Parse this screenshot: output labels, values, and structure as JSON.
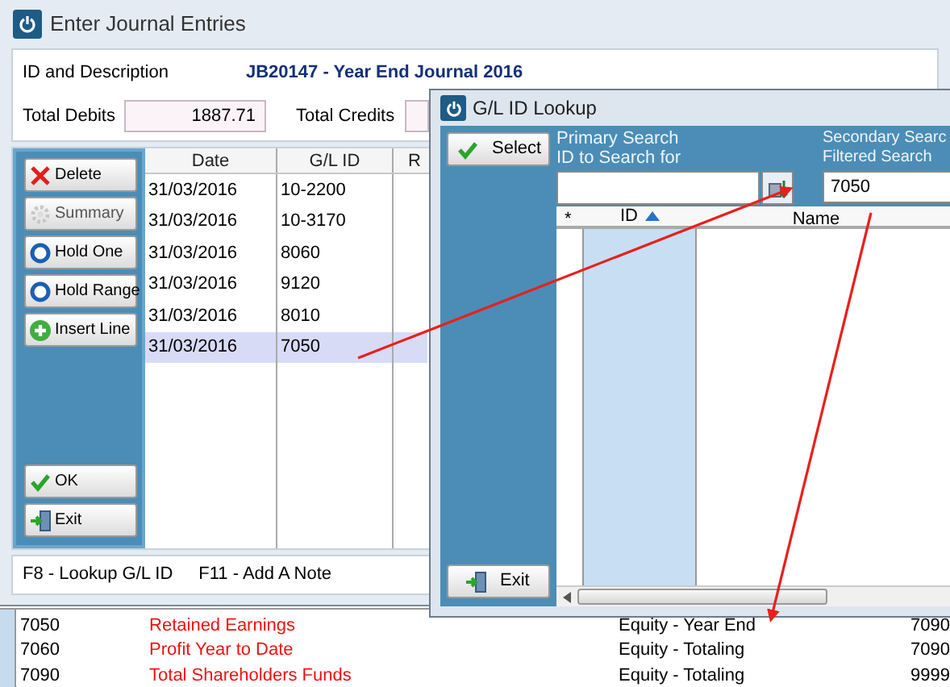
{
  "main_window": {
    "title": "Enter Journal Entries",
    "id_label": "ID and Description",
    "id_value": "JB20147 - Year End Journal 2016",
    "totals": [
      {
        "label": "Total Debits",
        "value": "1887.71"
      },
      {
        "label": "Total Credits"
      }
    ],
    "actions": [
      {
        "label": "Delete",
        "kind": "delete",
        "disabled": false
      },
      {
        "label": "Summary",
        "kind": "summary",
        "disabled": true
      },
      {
        "label": "Hold One",
        "kind": "hold",
        "disabled": false
      },
      {
        "label": "Hold Range",
        "kind": "hold",
        "disabled": false
      },
      {
        "label": "Insert Line",
        "kind": "insert",
        "disabled": false
      }
    ],
    "bottom_actions": [
      {
        "label": "OK",
        "kind": "ok"
      },
      {
        "label": "Exit",
        "kind": "exit"
      }
    ],
    "grid": {
      "columns": [
        "Date",
        "G/L ID",
        "R"
      ],
      "rows": [
        {
          "date": "31/03/2016",
          "gl_id": "10-2200",
          "selected": false
        },
        {
          "date": "31/03/2016",
          "gl_id": "10-3170",
          "selected": false
        },
        {
          "date": "31/03/2016",
          "gl_id": "8060",
          "selected": false
        },
        {
          "date": "31/03/2016",
          "gl_id": "9120",
          "selected": false
        },
        {
          "date": "31/03/2016",
          "gl_id": "8010",
          "selected": false
        },
        {
          "date": "31/03/2016",
          "gl_id": "7050",
          "selected": true
        }
      ]
    },
    "hints": [
      "F8 - Lookup G/L ID",
      "F11 - Add A Note"
    ]
  },
  "lookup_window": {
    "title": "G/L ID Lookup",
    "select_button": "Select",
    "exit_button": "Exit",
    "primary_search": {
      "label_1": "Primary Search",
      "label_2": "ID to Search for"
    },
    "secondary_search": {
      "label_1": "Secondary Searc",
      "label_2": "Filtered Search",
      "value": "7050"
    },
    "columns": [
      "*",
      "ID",
      "Name"
    ]
  },
  "background_table": {
    "rows": [
      {
        "id": "7050",
        "name": "Retained Earnings",
        "type": "Equity - Year End",
        "column_4": "7090"
      },
      {
        "id": "7060",
        "name": "Profit Year to Date",
        "type": "Equity - Totaling",
        "column_4": "7090"
      },
      {
        "id": "7090",
        "name": "Total Shareholders Funds",
        "type": "Equity - Totaling",
        "column_4": "9999"
      }
    ]
  }
}
